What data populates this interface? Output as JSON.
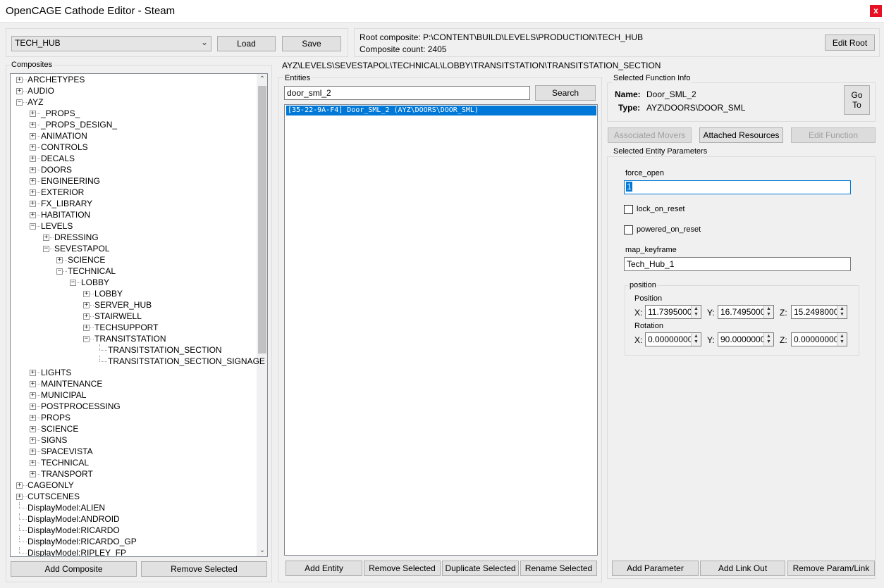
{
  "window": {
    "title": "OpenCAGE Cathode Editor - Steam",
    "close_glyph": "x"
  },
  "top": {
    "level_selected": "TECH_HUB",
    "load_label": "Load",
    "save_label": "Save",
    "root_composite": "Root composite: P:\\CONTENT\\BUILD\\LEVELS\\PRODUCTION\\TECH_HUB",
    "composite_count": "Composite count: 2405",
    "edit_root_label": "Edit Root"
  },
  "composites": {
    "label": "Composites",
    "nodes": [
      {
        "text": "ARCHETYPES",
        "depth": 0,
        "exp": "+"
      },
      {
        "text": "AUDIO",
        "depth": 0,
        "exp": "+"
      },
      {
        "text": "AYZ",
        "depth": 0,
        "exp": "-"
      },
      {
        "text": "_PROPS_",
        "depth": 1,
        "exp": "+"
      },
      {
        "text": "_PROPS_DESIGN_",
        "depth": 1,
        "exp": "+"
      },
      {
        "text": "ANIMATION",
        "depth": 1,
        "exp": "+"
      },
      {
        "text": "CONTROLS",
        "depth": 1,
        "exp": "+"
      },
      {
        "text": "DECALS",
        "depth": 1,
        "exp": "+"
      },
      {
        "text": "DOORS",
        "depth": 1,
        "exp": "+"
      },
      {
        "text": "ENGINEERING",
        "depth": 1,
        "exp": "+"
      },
      {
        "text": "EXTERIOR",
        "depth": 1,
        "exp": "+"
      },
      {
        "text": "FX_LIBRARY",
        "depth": 1,
        "exp": "+"
      },
      {
        "text": "HABITATION",
        "depth": 1,
        "exp": "+"
      },
      {
        "text": "LEVELS",
        "depth": 1,
        "exp": "-"
      },
      {
        "text": "DRESSING",
        "depth": 2,
        "exp": "+"
      },
      {
        "text": "SEVESTAPOL",
        "depth": 2,
        "exp": "-"
      },
      {
        "text": "SCIENCE",
        "depth": 3,
        "exp": "+"
      },
      {
        "text": "TECHNICAL",
        "depth": 3,
        "exp": "-"
      },
      {
        "text": "LOBBY",
        "depth": 4,
        "exp": "-"
      },
      {
        "text": "LOBBY",
        "depth": 5,
        "exp": "+"
      },
      {
        "text": "SERVER_HUB",
        "depth": 5,
        "exp": "+"
      },
      {
        "text": "STAIRWELL",
        "depth": 5,
        "exp": "+"
      },
      {
        "text": "TECHSUPPORT",
        "depth": 5,
        "exp": "+"
      },
      {
        "text": "TRANSITSTATION",
        "depth": 5,
        "exp": "-"
      },
      {
        "text": "TRANSITSTATION_SECTION",
        "depth": 6,
        "exp": ""
      },
      {
        "text": "TRANSITSTATION_SECTION_SIGNAGE",
        "depth": 6,
        "exp": ""
      },
      {
        "text": "LIGHTS",
        "depth": 1,
        "exp": "+"
      },
      {
        "text": "MAINTENANCE",
        "depth": 1,
        "exp": "+"
      },
      {
        "text": "MUNICIPAL",
        "depth": 1,
        "exp": "+"
      },
      {
        "text": "POSTPROCESSING",
        "depth": 1,
        "exp": "+"
      },
      {
        "text": "PROPS",
        "depth": 1,
        "exp": "+"
      },
      {
        "text": "SCIENCE",
        "depth": 1,
        "exp": "+"
      },
      {
        "text": "SIGNS",
        "depth": 1,
        "exp": "+"
      },
      {
        "text": "SPACEVISTA",
        "depth": 1,
        "exp": "+"
      },
      {
        "text": "TECHNICAL",
        "depth": 1,
        "exp": "+"
      },
      {
        "text": "TRANSPORT",
        "depth": 1,
        "exp": "+"
      },
      {
        "text": "CAGEONLY",
        "depth": 0,
        "exp": "+"
      },
      {
        "text": "CUTSCENES",
        "depth": 0,
        "exp": "+"
      },
      {
        "text": "DisplayModel:ALIEN",
        "depth": 0,
        "exp": ""
      },
      {
        "text": "DisplayModel:ANDROID",
        "depth": 0,
        "exp": ""
      },
      {
        "text": "DisplayModel:RICARDO",
        "depth": 0,
        "exp": ""
      },
      {
        "text": "DisplayModel:RICARDO_GP",
        "depth": 0,
        "exp": ""
      },
      {
        "text": "DisplayModel:RIPLEY_FP",
        "depth": 0,
        "exp": ""
      }
    ],
    "add_label": "Add Composite",
    "remove_label": "Remove Selected"
  },
  "path": "AYZ\\LEVELS\\SEVESTAPOL\\TECHNICAL\\LOBBY\\TRANSITSTATION\\TRANSITSTATION_SECTION",
  "entities": {
    "label": "Entities",
    "search_value": "door_sml_2",
    "search_label": "Search",
    "items": [
      "[35-22-9A-F4] Door_SML_2 (AYZ\\DOORS\\DOOR_SML)"
    ],
    "add_label": "Add Entity",
    "remove_label": "Remove Selected",
    "duplicate_label": "Duplicate Selected",
    "rename_label": "Rename Selected"
  },
  "function_info": {
    "label": "Selected Function Info",
    "name_key": "Name:",
    "name_val": "Door_SML_2",
    "type_key": "Type:",
    "type_val": "AYZ\\DOORS\\DOOR_SML",
    "goto_line1": "Go",
    "goto_line2": "To",
    "assoc_label": "Associated Movers",
    "attached_label": "Attached Resources",
    "edit_fn_label": "Edit Function"
  },
  "params": {
    "label": "Selected Entity Parameters",
    "force_open_label": "force_open",
    "force_open_value": "1",
    "lock_on_reset": "lock_on_reset",
    "powered_on_reset": "powered_on_reset",
    "map_keyframe_label": "map_keyframe",
    "map_keyframe_value": "Tech_Hub_1",
    "position_group": "position",
    "position_label": "Position",
    "rotation_label": "Rotation",
    "x": "X:",
    "y": "Y:",
    "z": "Z:",
    "pos_x": "11.7395000(",
    "pos_y": "16.7495000(",
    "pos_z": "15.2498000(",
    "rot_x": "0.00000000",
    "rot_y": "90.0000000(",
    "rot_z": "0.00000000",
    "add_param_label": "Add Parameter",
    "add_link_label": "Add Link Out",
    "remove_param_label": "Remove Param/Link"
  },
  "colors": {
    "selection": "#0078d7",
    "close_red": "#e81123"
  }
}
